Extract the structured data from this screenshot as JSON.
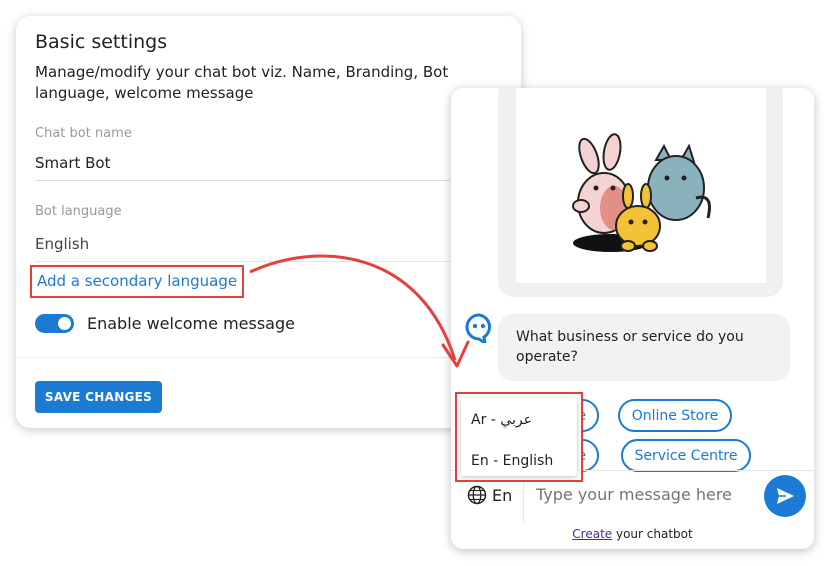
{
  "settings": {
    "title": "Basic settings",
    "description": "Manage/modify your chat bot viz. Name, Branding, Bot language, welcome message",
    "bot_name_label": "Chat bot name",
    "bot_name_value": "Smart Bot",
    "bot_language_label": "Bot language",
    "bot_language_value": "English",
    "add_secondary_language": "Add a secondary language",
    "welcome_toggle_label": "Enable welcome message",
    "welcome_toggle_on": true,
    "save_button": "SAVE CHANGES"
  },
  "chat": {
    "bot_message": "What business or service do you operate?",
    "chips": [
      {
        "label": "re"
      },
      {
        "label": "Online Store"
      },
      {
        "label": "re"
      },
      {
        "label": "Service Centre"
      }
    ],
    "language_button": "En",
    "input_placeholder": "Type your message here",
    "footer_link": "Create",
    "footer_text": " your chatbot"
  },
  "language_dropdown": {
    "options": [
      {
        "label": "Ar - عربي"
      },
      {
        "label": "En - English"
      }
    ]
  },
  "colors": {
    "accent": "#1a7ad4",
    "highlight": "#e5413b"
  }
}
